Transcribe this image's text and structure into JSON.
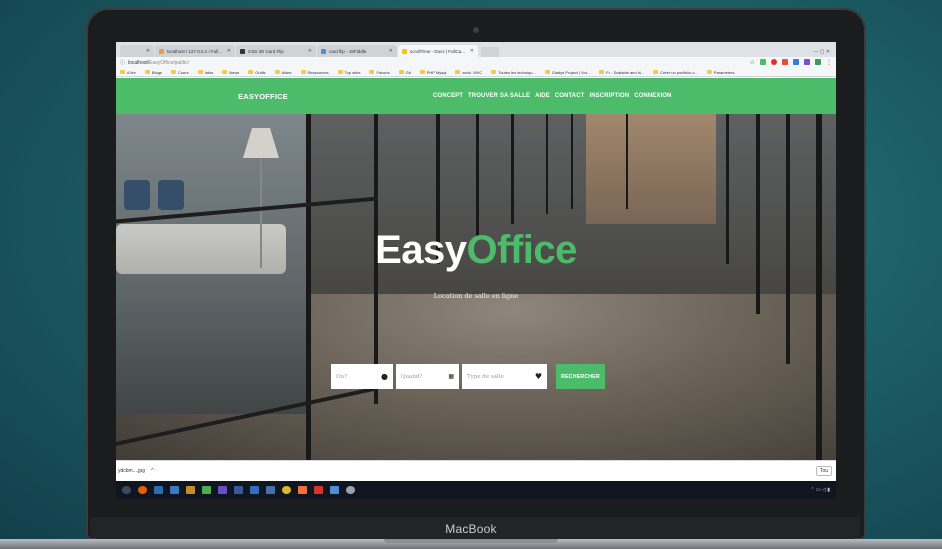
{
  "browser": {
    "tabs": [
      {
        "label": "",
        "color": "#cfd3d8"
      },
      {
        "label": "localhost / 127.0.0.1 / Full...",
        "color": "#f29b38"
      },
      {
        "label": "CSS 3D Card Flip",
        "color": "#333333"
      },
      {
        "label": "card flip - JSFiddle",
        "color": "#4a90d9"
      },
      {
        "label": "scrollTime - Docs | FullCa...",
        "color": "#f5c518",
        "active": true
      }
    ],
    "url_host": "localhost/",
    "url_path": "EasyOffice/public/",
    "bookmarks": [
      "A lire",
      "Blogs",
      "Cours",
      "Infos",
      "News",
      "Outils",
      "Aides",
      "Ressources",
      "Top sites",
      "Favoris",
      "Git",
      "PHP Mysql",
      "archi. MVC",
      "Toutes les techniqu...",
      "Gladys Project | Vot...",
      "Fr - Scalable and hi...",
      "Créer un portfolio o...",
      "Paramètres"
    ]
  },
  "site": {
    "logo": "EASYOFFICE",
    "nav": [
      "CONCEPT",
      "TROUVER SA SALLE",
      "AIDE",
      "CONTACT",
      "INSCRIPTION",
      "CONNEXION"
    ],
    "title_part1": "Easy",
    "title_part2": "Office",
    "subtitle": "Location de salle en ligne",
    "search": {
      "where_placeholder": "Où?",
      "when_placeholder": "Quand?",
      "type_placeholder": "Type de salle",
      "button": "RECHERCHER"
    },
    "accent_color": "#4cbb6a"
  },
  "download_bar": {
    "item": "ydcbm....jpg",
    "show_all": "Tou"
  },
  "device": {
    "brand": "MacBook"
  }
}
